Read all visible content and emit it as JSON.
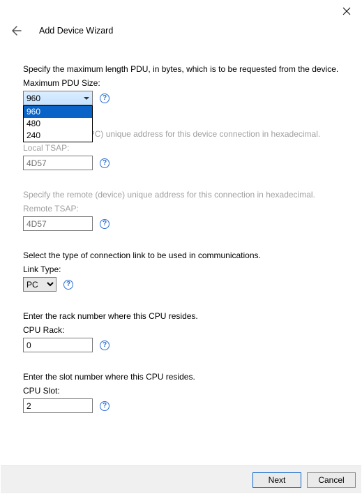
{
  "window": {
    "title": "Add Device Wizard"
  },
  "pdu": {
    "desc": "Specify the maximum length PDU, in bytes, which is to be requested from the device.",
    "label": "Maximum PDU Size:",
    "selected": "960",
    "options": [
      "960",
      "480",
      "240"
    ]
  },
  "local_tsap": {
    "desc": "Specify the local (PC) unique address for this device connection in hexadecimal.",
    "label": "Local TSAP:",
    "value": "4D57"
  },
  "remote_tsap": {
    "desc": "Specify the remote (device) unique address for this connection in hexadecimal.",
    "label": "Remote TSAP:",
    "value": "4D57"
  },
  "link_type": {
    "desc": "Select the type of connection link to be used in communications.",
    "label": "Link Type:",
    "value": "PC"
  },
  "cpu_rack": {
    "desc": "Enter the rack number where this CPU resides.",
    "label": "CPU Rack:",
    "value": "0"
  },
  "cpu_slot": {
    "desc": "Enter the slot number where this CPU resides.",
    "label": "CPU Slot:",
    "value": "2"
  },
  "buttons": {
    "next": "Next",
    "cancel": "Cancel"
  },
  "help_glyph": "?"
}
